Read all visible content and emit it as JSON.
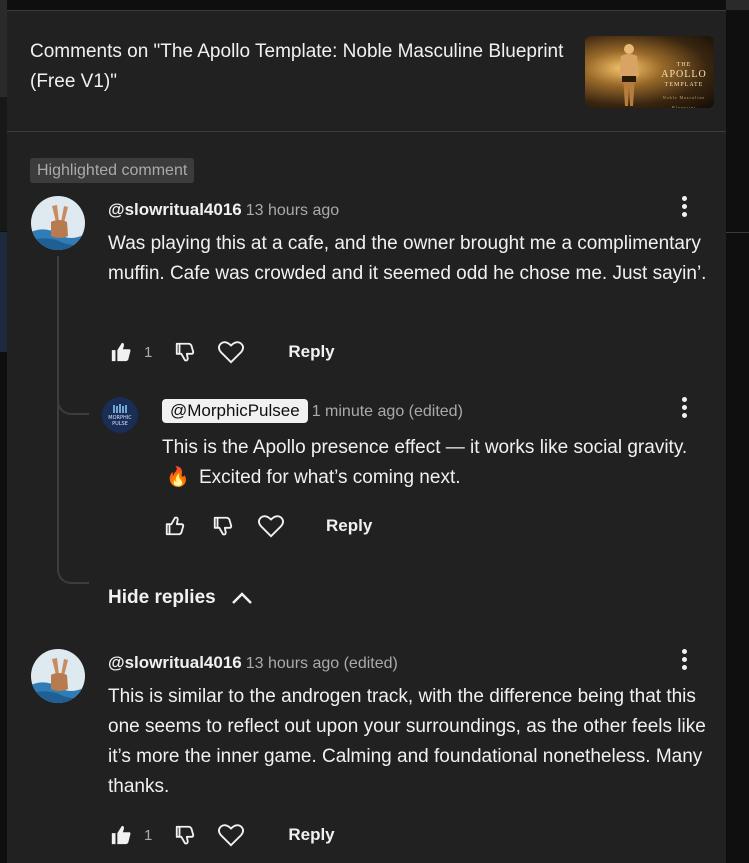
{
  "header": {
    "title": "Comments on \"The Apollo Template: Noble Masculine Blueprint (Free V1)\"",
    "thumbnail": {
      "brand_small": "THE",
      "brand": "APOLLO",
      "brand_sub": "TEMPLATE",
      "tagline": "Noble Masculine Blueprint"
    }
  },
  "highlighted_label": "Highlighted comment",
  "comments": [
    {
      "author": "@slowritual4016",
      "time": "13 hours ago",
      "text": "Was playing this at a cafe, and the owner brought me a complimentary muffin. Cafe was crowded and it seemed odd he chose me. Just sayin’.",
      "likes": "1",
      "reply_label": "Reply",
      "liked": true,
      "avatar_icon": "peace-hand-icon"
    },
    {
      "author": "@slowritual4016",
      "time": "13 hours ago (edited)",
      "text": "This is similar to the androgen track, with the difference being that this one seems to reflect out upon your surroundings, as the other feels like it’s more the inner game. Calming and foundational nonetheless. Many thanks.",
      "likes": "1",
      "reply_label": "Reply",
      "liked": true,
      "avatar_icon": "peace-hand-icon"
    }
  ],
  "reply": {
    "author": "@MorphicPulsee",
    "time": "1 minute ago (edited)",
    "text_before": "This is the Apollo presence effect — it works like social gravity.",
    "emoji": "🔥",
    "text_after": "Excited for what’s coming next.",
    "reply_label": "Reply",
    "avatar_text_1": "MORPHIC",
    "avatar_text_2": "PULSE"
  },
  "hide_replies_label": "Hide replies",
  "colors": {
    "panel": "#212121",
    "text": "#f1f1f1",
    "muted": "#aaaaaa",
    "badge": "#3c3c3c"
  }
}
